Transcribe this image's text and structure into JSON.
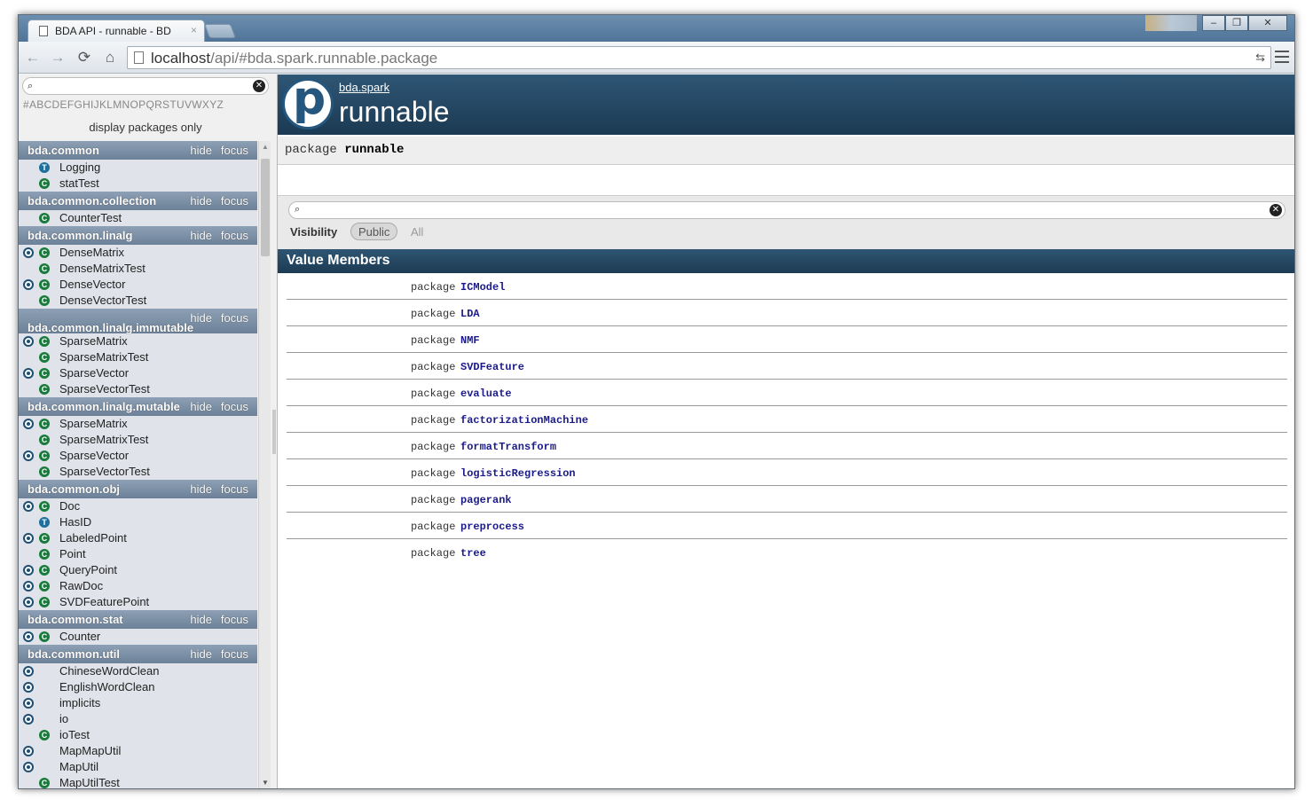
{
  "browser": {
    "tab_title": "BDA API - runnable - BD",
    "tab_close": "×",
    "url_host": "localhost",
    "url_path": "/api/#bda.spark.runnable.package",
    "window_buttons": [
      "–",
      "❐",
      "✕"
    ]
  },
  "sidebar": {
    "search_placeholder": "",
    "letters": "#ABCDEFGHIJKLMNOPQRSTUVWXYZ",
    "display_packages_only": "display packages only",
    "hide_label": "hide",
    "focus_label": "focus",
    "packages": [
      {
        "name": "bda.common",
        "entries": [
          {
            "name": "Logging",
            "object": false,
            "kind": "T"
          },
          {
            "name": "statTest",
            "object": false,
            "kind": "C"
          }
        ]
      },
      {
        "name": "bda.common.collection",
        "entries": [
          {
            "name": "CounterTest",
            "object": false,
            "kind": "C"
          }
        ]
      },
      {
        "name": "bda.common.linalg",
        "entries": [
          {
            "name": "DenseMatrix",
            "object": true,
            "kind": "C"
          },
          {
            "name": "DenseMatrixTest",
            "object": false,
            "kind": "C"
          },
          {
            "name": "DenseVector",
            "object": true,
            "kind": "C"
          },
          {
            "name": "DenseVectorTest",
            "object": false,
            "kind": "C"
          }
        ]
      },
      {
        "name": "bda.common.linalg.immutable",
        "tall": true,
        "entries": [
          {
            "name": "SparseMatrix",
            "object": true,
            "kind": "C"
          },
          {
            "name": "SparseMatrixTest",
            "object": false,
            "kind": "C"
          },
          {
            "name": "SparseVector",
            "object": true,
            "kind": "C"
          },
          {
            "name": "SparseVectorTest",
            "object": false,
            "kind": "C"
          }
        ]
      },
      {
        "name": "bda.common.linalg.mutable",
        "entries": [
          {
            "name": "SparseMatrix",
            "object": true,
            "kind": "C"
          },
          {
            "name": "SparseMatrixTest",
            "object": false,
            "kind": "C"
          },
          {
            "name": "SparseVector",
            "object": true,
            "kind": "C"
          },
          {
            "name": "SparseVectorTest",
            "object": false,
            "kind": "C"
          }
        ]
      },
      {
        "name": "bda.common.obj",
        "entries": [
          {
            "name": "Doc",
            "object": true,
            "kind": "C"
          },
          {
            "name": "HasID",
            "object": false,
            "kind": "T"
          },
          {
            "name": "LabeledPoint",
            "object": true,
            "kind": "C"
          },
          {
            "name": "Point",
            "object": false,
            "kind": "C"
          },
          {
            "name": "QueryPoint",
            "object": true,
            "kind": "C"
          },
          {
            "name": "RawDoc",
            "object": true,
            "kind": "C"
          },
          {
            "name": "SVDFeaturePoint",
            "object": true,
            "kind": "C"
          }
        ]
      },
      {
        "name": "bda.common.stat",
        "entries": [
          {
            "name": "Counter",
            "object": true,
            "kind": "C"
          }
        ]
      },
      {
        "name": "bda.common.util",
        "entries": [
          {
            "name": "ChineseWordClean",
            "object": true,
            "kind": ""
          },
          {
            "name": "EnglishWordClean",
            "object": true,
            "kind": ""
          },
          {
            "name": "implicits",
            "object": true,
            "kind": ""
          },
          {
            "name": "io",
            "object": true,
            "kind": ""
          },
          {
            "name": "ioTest",
            "object": false,
            "kind": "C"
          },
          {
            "name": "MapMapUtil",
            "object": true,
            "kind": ""
          },
          {
            "name": "MapUtil",
            "object": true,
            "kind": ""
          },
          {
            "name": "MapUtilTest",
            "object": false,
            "kind": "C"
          }
        ]
      }
    ]
  },
  "main": {
    "logo_letter": "p",
    "breadcrumb": "bda.spark",
    "title": "runnable",
    "signature_keyword": "package",
    "signature_name": "runnable",
    "visibility_label": "Visibility",
    "visibility_public": "Public",
    "visibility_all": "All",
    "value_members_title": "Value Members",
    "members": [
      {
        "kw": "package",
        "name": "ICModel"
      },
      {
        "kw": "package",
        "name": "LDA"
      },
      {
        "kw": "package",
        "name": "NMF"
      },
      {
        "kw": "package",
        "name": "SVDFeature"
      },
      {
        "kw": "package",
        "name": "evaluate"
      },
      {
        "kw": "package",
        "name": "factorizationMachine"
      },
      {
        "kw": "package",
        "name": "formatTransform"
      },
      {
        "kw": "package",
        "name": "logisticRegression"
      },
      {
        "kw": "package",
        "name": "pagerank"
      },
      {
        "kw": "package",
        "name": "preprocess"
      },
      {
        "kw": "package",
        "name": "tree"
      }
    ]
  }
}
